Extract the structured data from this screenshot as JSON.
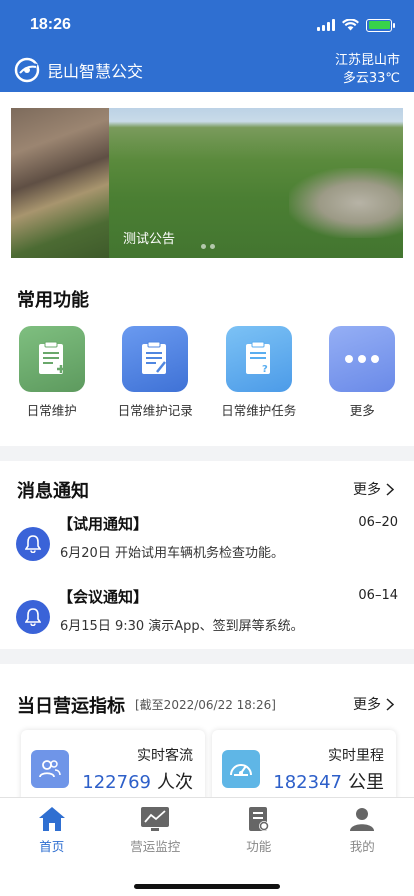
{
  "status": {
    "time": "18:26"
  },
  "header": {
    "app_title": "昆山智慧公交",
    "location": "江苏昆山市",
    "weather": "多云33℃"
  },
  "banner": {
    "caption": "测试公告"
  },
  "features": {
    "title": "常用功能",
    "items": [
      {
        "label": "日常维护",
        "icon": "clipboard-add-icon",
        "color": "#6aa86b"
      },
      {
        "label": "日常维护记录",
        "icon": "clipboard-edit-icon",
        "color": "#4f86e0"
      },
      {
        "label": "日常维护任务",
        "icon": "clipboard-question-icon",
        "color": "#5aaef0"
      },
      {
        "label": "更多",
        "icon": "more-dots-icon",
        "color": "#7c9cf0"
      }
    ]
  },
  "messages": {
    "title": "消息通知",
    "more_label": "更多",
    "items": [
      {
        "title": "【试用通知】",
        "date": "06–20",
        "body": "6月20日 开始试用车辆机务检查功能。"
      },
      {
        "title": "【会议通知】",
        "date": "06–14",
        "body": "6月15日 9:30 演示App、签到屏等系统。"
      }
    ]
  },
  "metrics": {
    "title": "当日营运指标",
    "as_of": "[截至2022/06/22 18:26]",
    "more_label": "更多",
    "cards": [
      {
        "label": "实时客流",
        "value": "122769",
        "unit": "人次",
        "icon": "passengers-icon"
      },
      {
        "label": "实时里程",
        "value": "182347",
        "unit": "公里",
        "icon": "speedometer-icon"
      }
    ]
  },
  "tabbar": {
    "active": 0,
    "items": [
      {
        "label": "首页",
        "icon": "home-icon"
      },
      {
        "label": "营运监控",
        "icon": "monitor-chart-icon"
      },
      {
        "label": "功能",
        "icon": "document-icon"
      },
      {
        "label": "我的",
        "icon": "person-icon"
      }
    ]
  },
  "colors": {
    "brand": "#2f6fd1",
    "accent_text": "#2d5fc9",
    "bell": "#3a63d8"
  }
}
